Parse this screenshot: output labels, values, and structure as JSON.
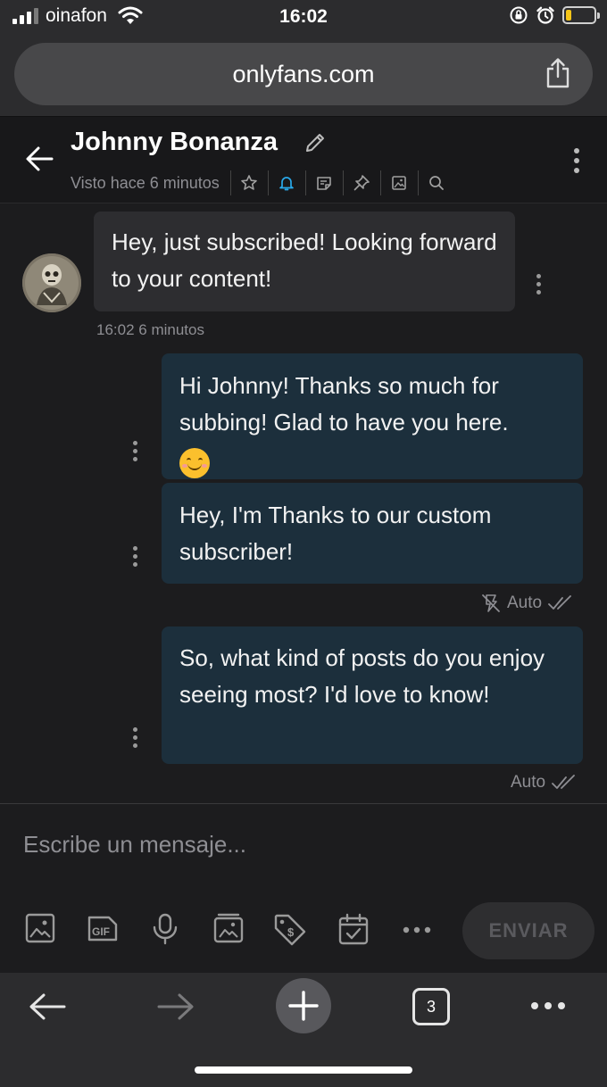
{
  "status_bar": {
    "carrier": "oinafon",
    "time": "16:02",
    "battery_level": 0.2
  },
  "browser": {
    "url": "onlyfans.com",
    "open_tabs": "3"
  },
  "chat": {
    "contact_name": "Johnny Bonanza",
    "last_seen": "Visto hace 6 minutos",
    "header_icons": [
      "star-icon",
      "bell-icon",
      "note-icon",
      "pin-icon",
      "image-icon",
      "search-icon"
    ]
  },
  "messages": [
    {
      "direction": "in",
      "text": "Hey, just subscribed! Looking forward to your content!",
      "meta": "16:02 6 minutos"
    },
    {
      "direction": "out",
      "text": "Hi Johnny! Thanks so much for subbing! Glad to have you here.",
      "emoji": "smiling-face"
    },
    {
      "direction": "out",
      "text": "Hey, I'm Thanks to our custom subscriber!",
      "status": "Auto"
    },
    {
      "direction": "out",
      "text": "So, what kind of posts do you enjoy seeing most? I'd love to know!",
      "status": "Auto"
    }
  ],
  "composer": {
    "placeholder": "Escribe un mensaje...",
    "send_label": "ENVIAR",
    "tools": [
      "image-icon",
      "gif-icon",
      "microphone-icon",
      "media-vault-icon",
      "price-tag-icon",
      "schedule-icon",
      "more-icon"
    ]
  },
  "colors": {
    "accent": "#29a9ea",
    "bubble_out": "#1c2f3c",
    "bubble_in": "#2d2d30"
  }
}
